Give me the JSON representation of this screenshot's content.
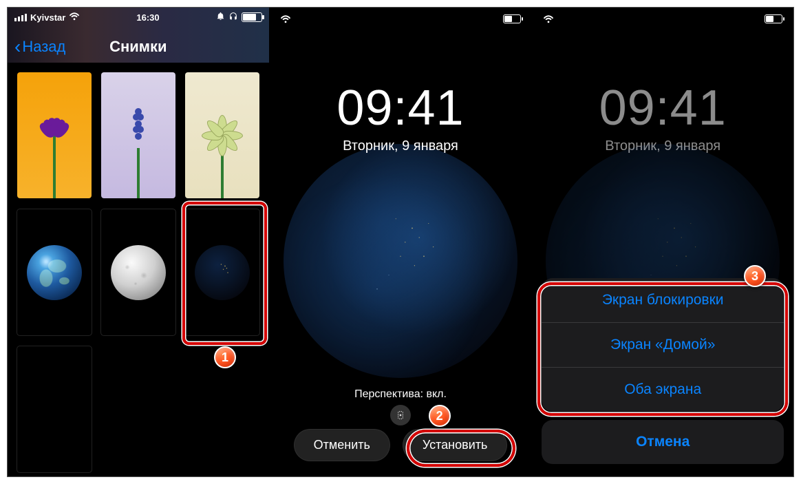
{
  "panel1": {
    "status": {
      "carrier": "Kyivstar",
      "time": "16:30"
    },
    "nav": {
      "back": "Назад",
      "title": "Снимки"
    },
    "battery_pct": 70,
    "thumbs": [
      {
        "id": "flower-purple",
        "selected": false
      },
      {
        "id": "flower-muscari",
        "selected": false
      },
      {
        "id": "flower-green",
        "selected": false
      },
      {
        "id": "earth-day",
        "selected": false
      },
      {
        "id": "moon",
        "selected": false
      },
      {
        "id": "earth-night",
        "selected": true
      },
      {
        "id": "empty",
        "selected": false
      }
    ]
  },
  "panel2": {
    "time": "09:41",
    "date": "Вторник, 9 января",
    "perspective": "Перспектива: вкл.",
    "cancel": "Отменить",
    "set": "Установить",
    "battery_pct": 45
  },
  "panel3": {
    "time": "09:41",
    "date": "Вторник, 9 января",
    "battery_pct": 45,
    "sheet": {
      "lock": "Экран блокировки",
      "home": "Экран «Домой»",
      "both": "Оба экрана",
      "cancel": "Отмена"
    }
  },
  "markers": {
    "m1": "1",
    "m2": "2",
    "m3": "3"
  }
}
